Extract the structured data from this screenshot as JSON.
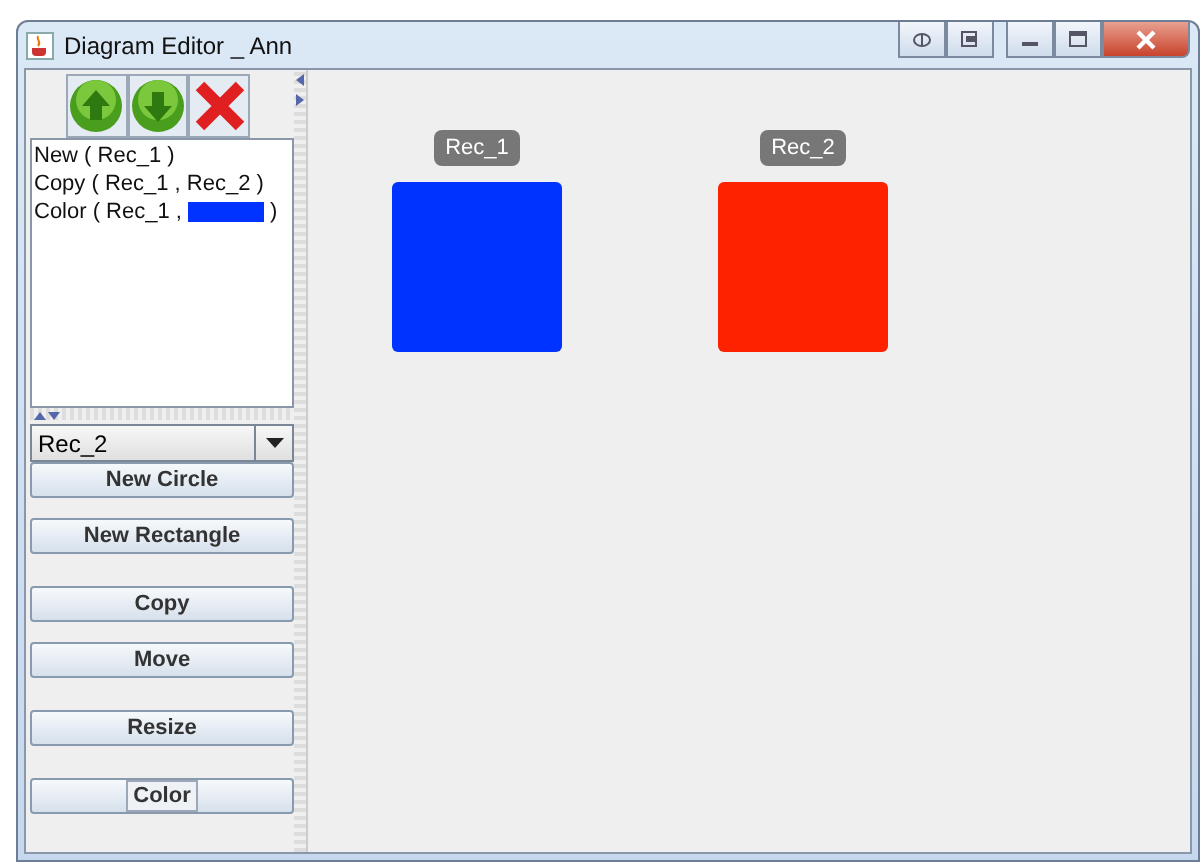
{
  "window": {
    "title": "Diagram Editor _ Ann"
  },
  "history": {
    "toolbar": [
      {
        "kind": "up"
      },
      {
        "kind": "down"
      },
      {
        "kind": "delete"
      }
    ],
    "lines": [
      {
        "text": "New ( Rec_1 )"
      },
      {
        "text": "Copy ( Rec_1 , Rec_2 )"
      },
      {
        "text": "Color ( Rec_1 ,",
        "color": "#0033ff",
        "after": ")"
      }
    ]
  },
  "shape_select": {
    "value": "Rec_2"
  },
  "button_groups": [
    [
      {
        "label": "New Circle",
        "focused": false
      },
      {
        "label": "New Rectangle",
        "focused": false
      }
    ],
    [
      {
        "label": "Copy",
        "focused": false
      },
      {
        "label": "Move",
        "focused": false
      }
    ],
    [
      {
        "label": "Resize",
        "focused": false
      }
    ],
    [
      {
        "label": "Color",
        "focused": true
      }
    ]
  ],
  "shapes": [
    {
      "kind": "rectangle",
      "label": "Rec_1",
      "color": "#0033ff"
    },
    {
      "kind": "rectangle",
      "label": "Rec_2",
      "color": "#ff2200"
    }
  ]
}
